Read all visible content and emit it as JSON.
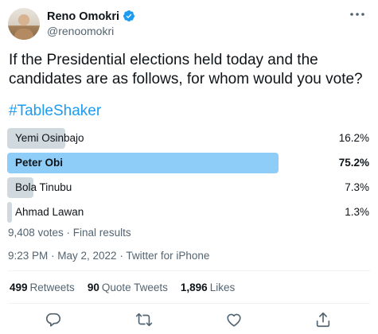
{
  "author": {
    "display_name": "Reno Omokri",
    "handle": "@renoomokri"
  },
  "tweet": {
    "text": "If the Presidential elections held today and the candidates are as follows, for whom would you vote?",
    "hashtag": "#TableShaker"
  },
  "poll": {
    "options": [
      {
        "label": "Yemi Osinbajo",
        "percent": 16.2,
        "percent_text": "16.2%",
        "winner": false
      },
      {
        "label": "Peter Obi",
        "percent": 75.2,
        "percent_text": "75.2%",
        "winner": true
      },
      {
        "label": "Bola Tinubu",
        "percent": 7.3,
        "percent_text": "7.3%",
        "winner": false
      },
      {
        "label": "Ahmad Lawan",
        "percent": 1.3,
        "percent_text": "1.3%",
        "winner": false
      }
    ],
    "meta": "9,408 votes · Final results"
  },
  "timestamp": "9:23 PM · May 2, 2022 · Twitter for iPhone",
  "stats": {
    "retweets_count": "499",
    "retweets_label": "Retweets",
    "quotes_count": "90",
    "quotes_label": "Quote Tweets",
    "likes_count": "1,896",
    "likes_label": "Likes"
  },
  "colors": {
    "accent": "#1d9bf0",
    "winner_bar": "#8ecdf8",
    "bar": "#cfd9de",
    "muted_text": "#536471"
  },
  "icons": [
    "verified-badge-icon",
    "more-icon",
    "reply-icon",
    "retweet-icon",
    "like-icon",
    "share-icon"
  ]
}
